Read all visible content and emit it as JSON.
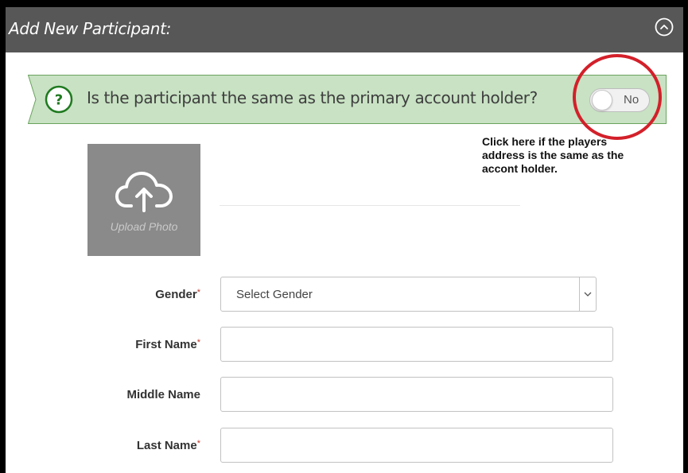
{
  "panel": {
    "title": "Add New Participant:",
    "collapse_icon": "chevron-up-circle-icon",
    "header_color": "#575757"
  },
  "banner": {
    "question": "Is the participant the same as the primary account holder?",
    "help_icon": "question-circle-icon",
    "background_color": "#c8e2c3",
    "toggle_label": "No",
    "toggle_state": "off"
  },
  "upload": {
    "label": "Upload Photo",
    "icon": "cloud-upload-icon"
  },
  "annotation": {
    "text": "Click here if the players address is the same as the accont holder.",
    "highlight_color": "#d3202a"
  },
  "form": {
    "required_marker": "*",
    "gender": {
      "label": "Gender",
      "selected": "Select Gender",
      "required": true
    },
    "first_name": {
      "label": "First Name",
      "value": "",
      "required": true
    },
    "middle_name": {
      "label": "Middle Name",
      "value": "",
      "required": false
    },
    "last_name": {
      "label": "Last Name",
      "value": "",
      "required": true
    }
  }
}
